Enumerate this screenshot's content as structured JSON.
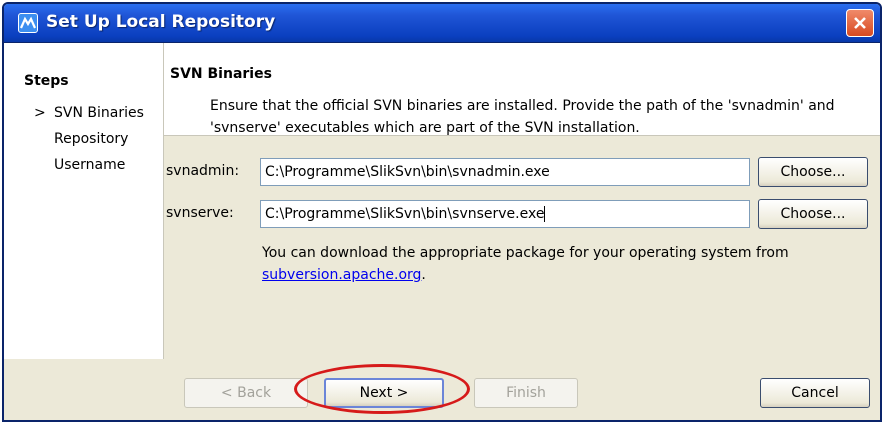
{
  "window": {
    "title": "Set Up Local Repository",
    "app_icon": "netbeans-icon",
    "close_icon": "close-icon"
  },
  "steps": {
    "heading": "Steps",
    "current_marker": ">",
    "items": [
      {
        "label": "SVN Binaries",
        "current": true
      },
      {
        "label": "Repository",
        "current": false
      },
      {
        "label": "Username",
        "current": false
      }
    ]
  },
  "section": {
    "title": "SVN Binaries",
    "description": "Ensure that the official SVN binaries are installed. Provide the path of the 'svnadmin' and 'svnserve' executables which are part of the SVN installation."
  },
  "fields": {
    "svnadmin": {
      "label": "svnadmin:",
      "value": "C:\\Programme\\SlikSvn\\bin\\svnadmin.exe",
      "button": "Choose..."
    },
    "svnserve": {
      "label": "svnserve:",
      "value": "C:\\Programme\\SlikSvn\\bin\\svnserve.exe",
      "button": "Choose..."
    }
  },
  "hint": {
    "text": "You can download the appropriate package for your operating system from",
    "link": "subversion.apache.org",
    "after_link": "."
  },
  "buttons": {
    "back": "< Back",
    "next": "Next >",
    "finish": "Finish",
    "cancel": "Cancel"
  },
  "colors": {
    "titlebar": "#0a3fbf",
    "highlight": "#d61a1a",
    "link": "#0000ee"
  }
}
